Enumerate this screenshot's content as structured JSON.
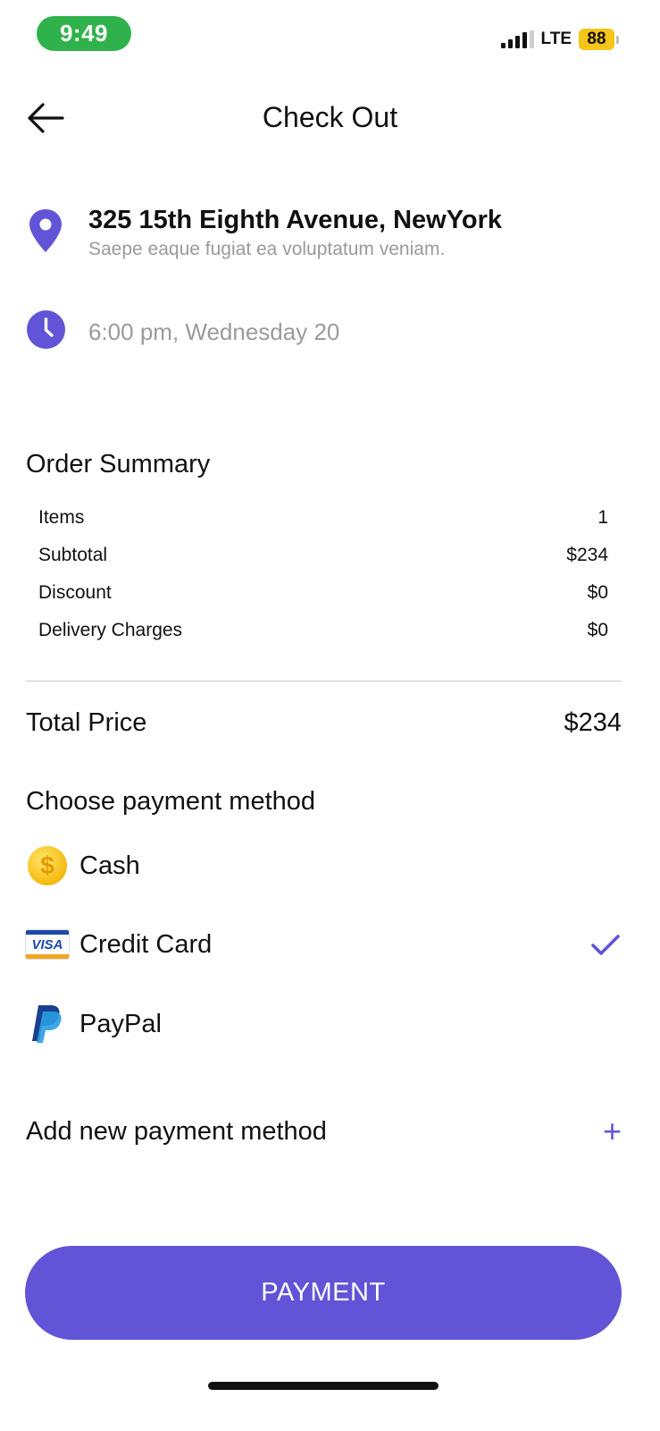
{
  "status_bar": {
    "time": "9:49",
    "network": "LTE",
    "battery": "88"
  },
  "header": {
    "title": "Check Out"
  },
  "address": {
    "title": "325 15th Eighth Avenue, NewYork",
    "subtitle": "Saepe eaque fugiat ea voluptatum veniam."
  },
  "delivery_time": "6:00 pm, Wednesday 20",
  "order_summary": {
    "title": "Order Summary",
    "rows": [
      {
        "label": "Items",
        "value": "1"
      },
      {
        "label": "Subtotal",
        "value": "$234"
      },
      {
        "label": "Discount",
        "value": "$0"
      },
      {
        "label": "Delivery Charges",
        "value": "$0"
      }
    ],
    "total_label": "Total Price",
    "total_value": "$234"
  },
  "payment": {
    "title": "Choose payment method",
    "methods": [
      {
        "label": "Cash",
        "icon": "coin-icon",
        "selected": false
      },
      {
        "label": "Credit Card",
        "icon": "visa-icon",
        "selected": true
      },
      {
        "label": "PayPal",
        "icon": "paypal-icon",
        "selected": false
      }
    ],
    "add_label": "Add new payment method",
    "add_icon": "+",
    "visa_text": "VISA",
    "cash_symbol": "$"
  },
  "button": {
    "label": "PAYMENT"
  },
  "colors": {
    "accent": "#6254d6",
    "time_pill": "#2fb24c",
    "battery": "#f5c518",
    "muted_text": "#9a9a9a"
  }
}
